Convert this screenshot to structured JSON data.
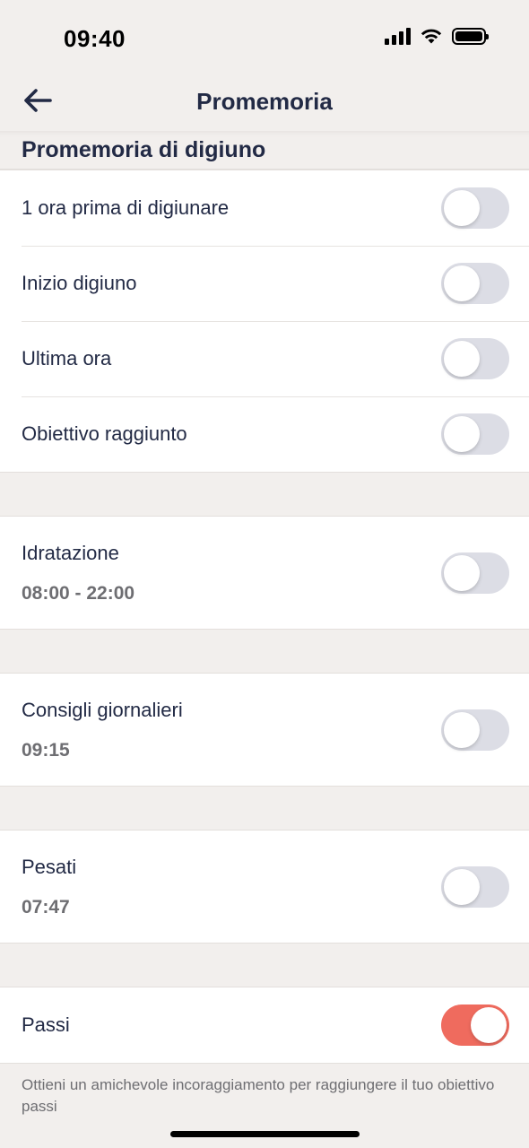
{
  "status_bar": {
    "time": "09:40",
    "signal_icon": "cellular-signal-icon",
    "wifi_icon": "wifi-icon",
    "battery_icon": "battery-icon"
  },
  "nav": {
    "title": "Promemoria",
    "back_icon": "arrow-left-icon"
  },
  "fasting_section": {
    "header": "Promemoria di digiuno",
    "items": [
      {
        "label": "1 ora prima di digiunare",
        "enabled": false
      },
      {
        "label": "Inizio digiuno",
        "enabled": false
      },
      {
        "label": "Ultima ora",
        "enabled": false
      },
      {
        "label": "Obiettivo raggiunto",
        "enabled": false
      }
    ]
  },
  "hydration": {
    "label": "Idratazione",
    "time": "08:00 - 22:00",
    "enabled": false
  },
  "daily_tips": {
    "label": "Consigli giornalieri",
    "time": "09:15",
    "enabled": false
  },
  "weigh": {
    "label": "Pesati",
    "time": "07:47",
    "enabled": false
  },
  "steps": {
    "label": "Passi",
    "enabled": true,
    "note": "Ottieni un amichevole incoraggiamento per raggiungere il tuo obiettivo passi"
  },
  "colors": {
    "accent": "#ef6b5e",
    "toggle_off": "#dcdde5",
    "text_primary": "#222a45",
    "background": "#f2efed"
  }
}
